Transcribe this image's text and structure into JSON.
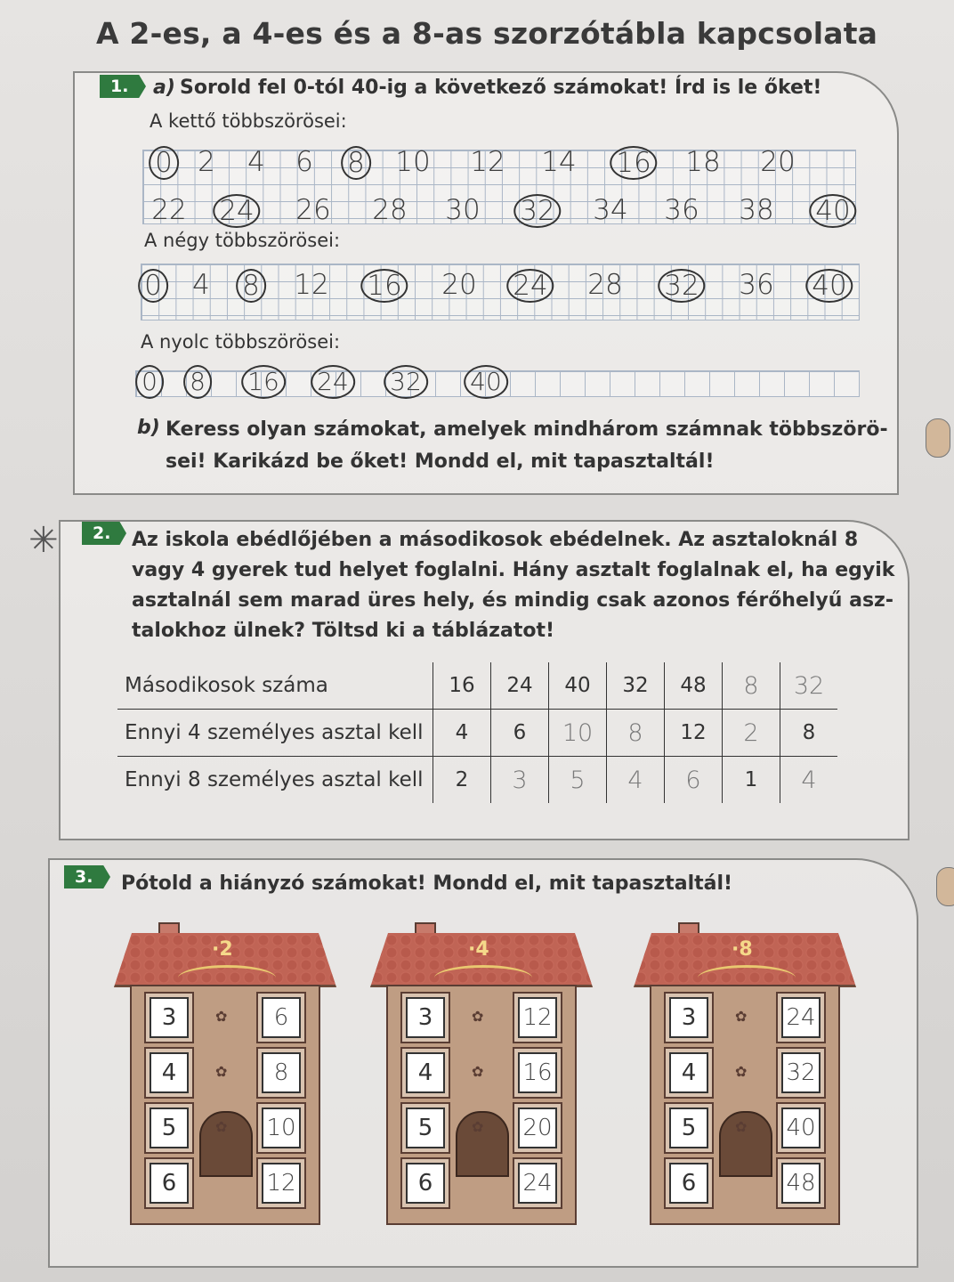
{
  "title": "A 2-es, a 4-es és a 8-as szorzótábla kapcsolata",
  "task1": {
    "number": "1.",
    "a_label": "a)",
    "a_text": "Sorold fel 0-tól 40-ig a következő számokat! Írd is le őket!",
    "twos_label": "A kettő többszörösei:",
    "fours_label": "A négy többszörösei:",
    "eights_label": "A nyolc többszörösei:",
    "twos_row1": [
      {
        "v": "0",
        "c": true
      },
      {
        "v": "2",
        "c": false
      },
      {
        "v": "4",
        "c": false
      },
      {
        "v": "6",
        "c": false
      },
      {
        "v": "8",
        "c": true
      },
      {
        "v": "10",
        "c": false
      },
      {
        "v": "12",
        "c": false
      },
      {
        "v": "14",
        "c": false
      },
      {
        "v": "16",
        "c": true
      },
      {
        "v": "18",
        "c": false
      },
      {
        "v": "20",
        "c": false
      }
    ],
    "twos_row2": [
      {
        "v": "22",
        "c": false
      },
      {
        "v": "24",
        "c": true
      },
      {
        "v": "26",
        "c": false
      },
      {
        "v": "28",
        "c": false
      },
      {
        "v": "30",
        "c": false
      },
      {
        "v": "32",
        "c": true
      },
      {
        "v": "34",
        "c": false
      },
      {
        "v": "36",
        "c": false
      },
      {
        "v": "38",
        "c": false
      },
      {
        "v": "40",
        "c": true
      }
    ],
    "fours": [
      {
        "v": "0",
        "c": true
      },
      {
        "v": "4",
        "c": false
      },
      {
        "v": "8",
        "c": true
      },
      {
        "v": "12",
        "c": false
      },
      {
        "v": "16",
        "c": true
      },
      {
        "v": "20",
        "c": false
      },
      {
        "v": "24",
        "c": true
      },
      {
        "v": "28",
        "c": false
      },
      {
        "v": "32",
        "c": true
      },
      {
        "v": "36",
        "c": false
      },
      {
        "v": "40",
        "c": true
      }
    ],
    "eights": [
      {
        "v": "0",
        "c": true
      },
      {
        "v": "8",
        "c": true
      },
      {
        "v": "16",
        "c": true
      },
      {
        "v": "24",
        "c": true
      },
      {
        "v": "32",
        "c": true
      },
      {
        "v": "40",
        "c": true
      }
    ],
    "b_label": "b)",
    "b_line1": "Keress olyan számokat, amelyek mindhárom számnak többszörö-",
    "b_line2": "sei! Karikázd be őket! Mondd el, mit tapasztaltál!"
  },
  "task2": {
    "number": "2.",
    "lines": [
      "Az iskola ebédlőjében a másodikosok ebédelnek. Az asztaloknál 8",
      "vagy 4 gyerek tud helyet foglalni. Hány asztalt foglalnak el, ha egyik",
      "asztalnál sem marad üres hely, és mindig csak azonos férőhelyű asz-",
      "talokhoz ülnek? Töltsd ki a táblázatot!"
    ],
    "rows": [
      {
        "label": "Másodikosok száma",
        "cells": [
          {
            "v": "16",
            "h": false
          },
          {
            "v": "24",
            "h": false
          },
          {
            "v": "40",
            "h": false
          },
          {
            "v": "32",
            "h": false
          },
          {
            "v": "48",
            "h": false
          },
          {
            "v": "8",
            "h": true
          },
          {
            "v": "32",
            "h": true
          }
        ]
      },
      {
        "label": "Ennyi 4 személyes asztal kell",
        "cells": [
          {
            "v": "4",
            "h": false
          },
          {
            "v": "6",
            "h": false
          },
          {
            "v": "10",
            "h": true
          },
          {
            "v": "8",
            "h": true
          },
          {
            "v": "12",
            "h": false
          },
          {
            "v": "2",
            "h": true
          },
          {
            "v": "8",
            "h": false
          }
        ]
      },
      {
        "label": "Ennyi 8 személyes asztal kell",
        "cells": [
          {
            "v": "2",
            "h": false
          },
          {
            "v": "3",
            "h": true
          },
          {
            "v": "5",
            "h": true
          },
          {
            "v": "4",
            "h": true
          },
          {
            "v": "6",
            "h": true
          },
          {
            "v": "1",
            "h": false
          },
          {
            "v": "4",
            "h": true
          }
        ]
      }
    ],
    "star": "✳"
  },
  "task3": {
    "number": "3.",
    "text": "Pótold a hiányzó számokat! Mondd el, mit tapasztaltál!",
    "houses": [
      {
        "op": "·2",
        "left": [
          "3",
          "4",
          "5",
          "6"
        ],
        "right": [
          "6",
          "8",
          "10",
          "12"
        ]
      },
      {
        "op": "·4",
        "left": [
          "3",
          "4",
          "5",
          "6"
        ],
        "right": [
          "12",
          "16",
          "20",
          "24"
        ]
      },
      {
        "op": "·8",
        "left": [
          "3",
          "4",
          "5",
          "6"
        ],
        "right": [
          "24",
          "32",
          "40",
          "48"
        ]
      }
    ]
  }
}
